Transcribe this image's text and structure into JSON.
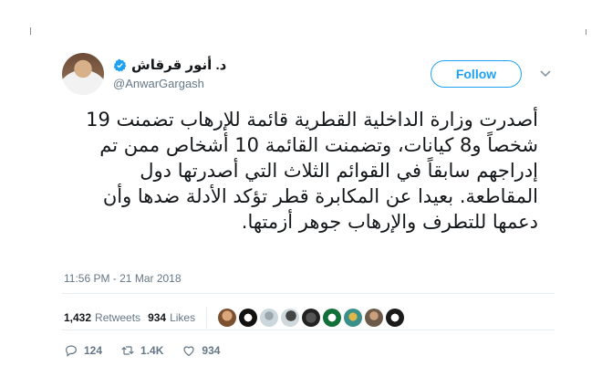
{
  "tweet": {
    "display_name": "د. أنور قرقاش",
    "handle": "@AnwarGargash",
    "follow_label": "Follow",
    "text": "أصدرت وزارة الداخلية القطرية قائمة للإرهاب تضمنت 19 شخصاً و8 كيانات، وتضمنت القائمة 10 أشخاص ممن تم إدراجهم سابقاً في القوائم الثلاث التي أصدرتها دول المقاطعة. بعيدا عن المكابرة قطر تؤكد الأدلة ضدها وأن دعمها للتطرف والإرهاب جوهر أزمتها.",
    "timestamp": "11:56 PM - 21 Mar 2018",
    "retweets_count": "1,432",
    "retweets_label": "Retweets",
    "likes_count": "934",
    "likes_label": "Likes",
    "reply_count": "124",
    "retweet_action_count": "1.4K",
    "like_action_count": "934"
  },
  "colors": {
    "accent": "#1da1f2",
    "secondary_text": "#657786",
    "divider": "#e6ecf0"
  },
  "icons": [
    "verified-badge-icon",
    "chevron-down-icon",
    "reply-icon",
    "retweet-icon",
    "like-icon"
  ]
}
